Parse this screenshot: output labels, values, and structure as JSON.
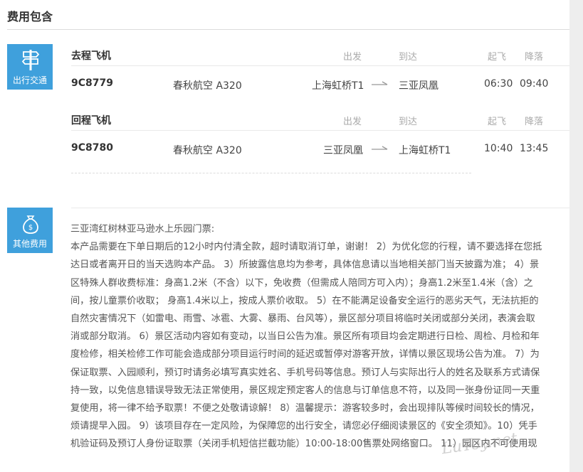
{
  "section_title": "费用包含",
  "transport": {
    "tile_label": "出行交通",
    "outbound": {
      "heading": "去程飞机",
      "cols": {
        "depart": "出发",
        "arrive": "到达",
        "takeoff": "起飞",
        "land": "降落"
      },
      "flight_no": "9C8779",
      "airline": "春秋航空  A320",
      "from": "上海虹桥T1",
      "to": "三亚凤凰",
      "takeoff_time": "06:30",
      "land_time": "09:40"
    },
    "return": {
      "heading": "回程飞机",
      "cols": {
        "depart": "出发",
        "arrive": "到达",
        "takeoff": "起飞",
        "land": "降落"
      },
      "flight_no": "9C8780",
      "airline": "春秋航空  A320",
      "from": "三亚凤凰",
      "to": "上海虹桥T1",
      "takeoff_time": "10:40",
      "land_time": "13:45"
    }
  },
  "other_fees": {
    "tile_label": "其他费用",
    "lines": [
      "三亚湾红树林亚马逊水上乐园门票:",
      "本产品需要在下单日期后的12小时内付清全款，超时请取消订单，谢谢！ 2）为优化您的行程，请不要选择在您抵",
      "达日或者离开日的当天选购本产品。 3）所披露信息均为参考，具体信息请以当地相关部门当天披露为准； 4）景",
      "区特殊人群收费标准：身高1.2米（不含）以下，免收费（但需成人陪同方可入内）；身高1.2米至1.4米（含）之",
      "间，按儿童票价收取； 身高1.4米以上，按成人票价收取。 5）在不能满足设备安全运行的恶劣天气，无法抗拒的",
      "自然灾害情况下（如雷电、雨雪、冰雹、大雾、暴雨、台风等），景区部分项目将临时关闭或部分关闭，表演会取",
      "消或部分取消。 6）景区活动内容如有变动，以当日公告为准。景区所有项目均会定期进行日检、周检、月检和年",
      "度检修，相关检修工作可能会造成部分项目运行时间的延迟或暂停对游客开放，详情以景区现场公告为准。 7）为",
      "保证取票、入园顺利，预订时请务必填写真实姓名、手机号码等信息。预订人与实际出行人的姓名及联系方式请保",
      "持一致，以免信息错误导致无法正常使用，景区规定预定客人的信息与订单信息不符，以及同一张身份证同一天重",
      "复使用，将一律不给予取票！不便之处敬请谅解！ 8）温馨提示：游客较多时，会出现排队等候时间较长的情况，",
      "烦请提早入园。 9）该项目存在一定风险，为保障您的出行安全，请您必仔细阅读景区的《安全须知》。10）凭手",
      "机验证码及预订人身份证取票（关闭手机短信拦截功能）10:00-18:00售票处网络窗口。 11）园区内不可使用现"
    ]
  },
  "watermark": "LuYoy.net",
  "colors": {
    "tile_bg": "#3fa0dc",
    "text": "#333333",
    "muted": "#aaaaaa"
  }
}
